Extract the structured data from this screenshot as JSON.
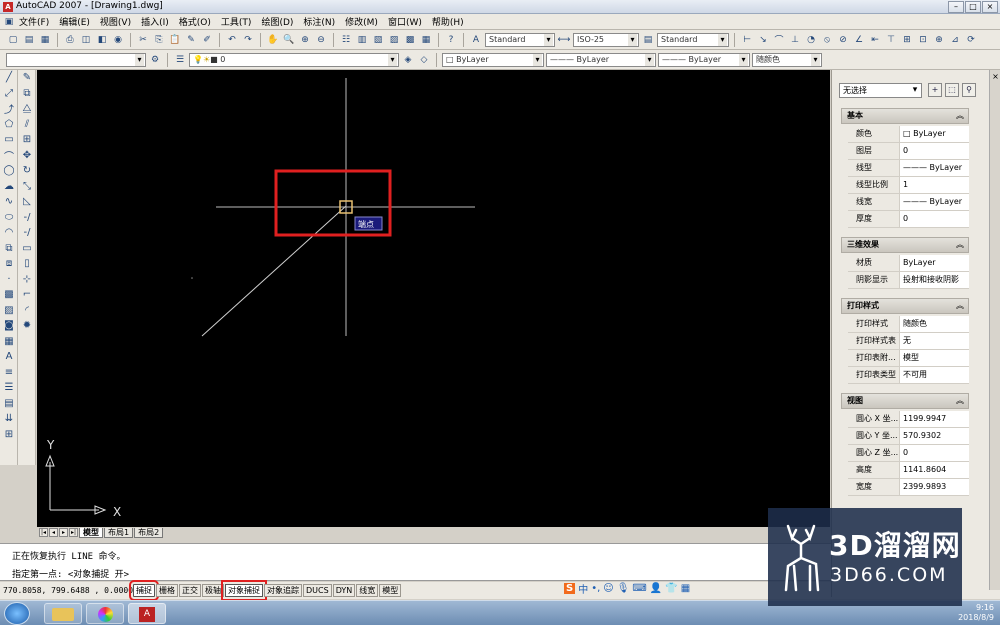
{
  "window": {
    "title": "AutoCAD 2007 - [Drawing1.dwg]",
    "controls": [
      "–",
      "□",
      "×"
    ]
  },
  "menu": [
    "文件(F)",
    "编辑(E)",
    "视图(V)",
    "插入(I)",
    "格式(O)",
    "工具(T)",
    "绘图(D)",
    "标注(N)",
    "修改(M)",
    "窗口(W)",
    "帮助(H)"
  ],
  "toolbar": {
    "text_style": "Standard",
    "dim_style": "ISO-25",
    "table_style": "Standard",
    "layer_value": "0",
    "color": "ByLayer",
    "linetype": "ByLayer",
    "lineweight": "ByLayer",
    "plot_style": "随颜色"
  },
  "canvas": {
    "snap_tooltip": "端点",
    "ucs_y": "Y",
    "ucs_x": "X"
  },
  "tabs": [
    "模型",
    "布局1",
    "布局2"
  ],
  "command": {
    "line1": "正在恢复执行 LINE 命令。",
    "line2": "指定第一点: <对象捕捉 开>"
  },
  "status": {
    "coords": "770.8058, 799.6488 , 0.0000",
    "buttons": [
      "捕捉",
      "栅格",
      "正交",
      "极轴",
      "对象捕捉",
      "对象追踪",
      "DUCS",
      "DYN",
      "线宽",
      "模型"
    ]
  },
  "panel": {
    "selection": "无选择",
    "sections": [
      {
        "title": "基本",
        "rows": [
          {
            "k": "颜色",
            "v": "□ ByLayer"
          },
          {
            "k": "图层",
            "v": "0"
          },
          {
            "k": "线型",
            "v": "——— ByLayer"
          },
          {
            "k": "线型比例",
            "v": "1"
          },
          {
            "k": "线宽",
            "v": "——— ByLayer"
          },
          {
            "k": "厚度",
            "v": "0"
          }
        ]
      },
      {
        "title": "三维效果",
        "rows": [
          {
            "k": "材质",
            "v": "ByLayer"
          },
          {
            "k": "阴影显示",
            "v": "投射和接收阴影"
          }
        ]
      },
      {
        "title": "打印样式",
        "rows": [
          {
            "k": "打印样式",
            "v": "随颜色"
          },
          {
            "k": "打印样式表",
            "v": "无"
          },
          {
            "k": "打印表附...",
            "v": "模型"
          },
          {
            "k": "打印表类型",
            "v": "不可用"
          }
        ]
      },
      {
        "title": "视图",
        "rows": [
          {
            "k": "圆心 X 坐...",
            "v": "1199.9947"
          },
          {
            "k": "圆心 Y 坐...",
            "v": "570.9302"
          },
          {
            "k": "圆心 Z 坐...",
            "v": "0"
          },
          {
            "k": "高度",
            "v": "1141.8604"
          },
          {
            "k": "宽度",
            "v": "2399.9893"
          }
        ]
      }
    ]
  },
  "ime": [
    "S",
    "中",
    "•,",
    "☺",
    "🎙",
    "⌨",
    "👤",
    "👕",
    "▦"
  ],
  "taskbar": {
    "time": "9:16",
    "date": "2018/8/9"
  },
  "watermark": {
    "big": "3D溜溜网",
    "small": "3D66.COM"
  },
  "colors": {
    "canvas": "#000000",
    "highlight": "#e02020",
    "crosshair": "#ffffff"
  }
}
